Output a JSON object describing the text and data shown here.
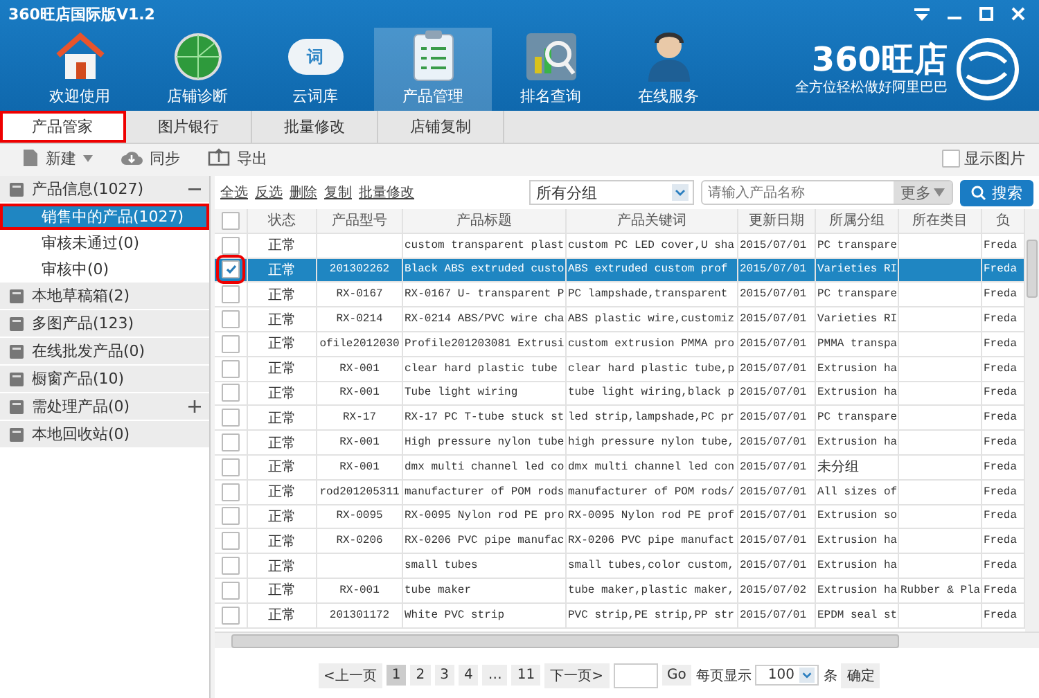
{
  "window": {
    "title": "360旺店国际版V1.2"
  },
  "nav": [
    {
      "label": "欢迎使用",
      "kind": "house",
      "selected": false
    },
    {
      "label": "店铺诊断",
      "kind": "globe",
      "selected": false
    },
    {
      "label": "云词库",
      "kind": "cloud",
      "icon_text": "词",
      "selected": false
    },
    {
      "label": "产品管理",
      "kind": "clipboard",
      "selected": true
    },
    {
      "label": "排名查询",
      "kind": "chart",
      "selected": false
    },
    {
      "label": "在线服务",
      "kind": "person",
      "selected": false
    }
  ],
  "brand": {
    "name": "360旺店",
    "slogan": "全方位轻松做好阿里巴巴"
  },
  "subtabs": [
    {
      "label": "产品管家",
      "selected": true
    },
    {
      "label": "图片银行",
      "selected": false
    },
    {
      "label": "批量修改",
      "selected": false
    },
    {
      "label": "店铺复制",
      "selected": false
    }
  ],
  "toolbar": {
    "buttons": [
      {
        "label": "新建",
        "kind": "doc",
        "dropdown": true
      },
      {
        "label": "同步",
        "kind": "cloud",
        "dropdown": false
      },
      {
        "label": "导出",
        "kind": "export",
        "dropdown": false
      }
    ],
    "show_images": {
      "label": "显示图片",
      "checked": false
    }
  },
  "sidebar": [
    {
      "label": "产品信息(1027)",
      "expanded": true,
      "children": [
        {
          "label": "销售中的产品(1027)",
          "selected": true
        },
        {
          "label": "审核未通过(0)",
          "selected": false
        },
        {
          "label": "审核中(0)",
          "selected": false
        }
      ]
    },
    {
      "label": "本地草稿箱(2)"
    },
    {
      "label": "多图产品(123)"
    },
    {
      "label": "在线批发产品(0)"
    },
    {
      "label": "橱窗产品(10)"
    },
    {
      "label": "需处理产品(0)",
      "expanded": false
    },
    {
      "label": "本地回收站(0)"
    }
  ],
  "actions": [
    "全选",
    "反选",
    "删除",
    "复制",
    "批量修改"
  ],
  "group_filter": {
    "value": "所有分组"
  },
  "search": {
    "placeholder": "请输入产品名称",
    "more": "更多",
    "button": "搜索"
  },
  "table": {
    "all_checked": false,
    "columns": [
      "状态",
      "产品型号",
      "产品标题",
      "产品关键词",
      "更新日期",
      "所属分组",
      "所在类目",
      "负"
    ],
    "rows": [
      {
        "checked": false,
        "selected": false,
        "cells": [
          "正常",
          "",
          "custom transparent plast",
          "custom PC LED cover,U sha",
          "2015/07/01",
          "PC transpare",
          "",
          "Freda"
        ]
      },
      {
        "checked": true,
        "selected": true,
        "cells": [
          "正常",
          "201302262",
          "Black ABS extruded custo",
          "ABS extruded  custom prof",
          "2015/07/01",
          "Varieties RI",
          "",
          "Freda"
        ]
      },
      {
        "checked": false,
        "selected": false,
        "cells": [
          "正常",
          "RX-0167",
          "RX-0167 U- transparent P",
          "PC lampshade,transparent",
          "2015/07/01",
          "PC transpare",
          "",
          "Freda"
        ]
      },
      {
        "checked": false,
        "selected": false,
        "cells": [
          "正常",
          "RX-0214",
          "RX-0214 ABS/PVC wire cha",
          "ABS plastic wire,customiz",
          "2015/07/01",
          "Varieties RI",
          "",
          "Freda"
        ]
      },
      {
        "checked": false,
        "selected": false,
        "cells": [
          "正常",
          "ofile2012030",
          "Profile201203081 Extrusi",
          "custom extrusion PMMA pro",
          "2015/07/01",
          "PMMA transpa",
          "",
          "Freda"
        ]
      },
      {
        "checked": false,
        "selected": false,
        "cells": [
          "正常",
          "RX-001",
          "clear hard plastic tube",
          "clear hard plastic tube,p",
          "2015/07/01",
          "Extrusion ha",
          "",
          "Freda"
        ]
      },
      {
        "checked": false,
        "selected": false,
        "cells": [
          "正常",
          "RX-001",
          "Tube light wiring",
          "tube light wiring,black p",
          "2015/07/01",
          "Extrusion ha",
          "",
          "Freda"
        ]
      },
      {
        "checked": false,
        "selected": false,
        "cells": [
          "正常",
          "RX-17",
          "RX-17 PC T-tube stuck st",
          "led strip,lampshade,PC pr",
          "2015/07/01",
          "PC transpare",
          "",
          "Freda"
        ]
      },
      {
        "checked": false,
        "selected": false,
        "cells": [
          "正常",
          "RX-001",
          "High pressure nylon tube",
          "high pressure nylon tube,",
          "2015/07/01",
          "Extrusion ha",
          "",
          "Freda"
        ]
      },
      {
        "checked": false,
        "selected": false,
        "cells": [
          "正常",
          "RX-001",
          "dmx multi channel led co",
          "dmx multi channel led con",
          "2015/07/01",
          "未分组",
          "",
          "Freda"
        ]
      },
      {
        "checked": false,
        "selected": false,
        "cells": [
          "正常",
          "rod201205311",
          "manufacturer of POM rods",
          "manufacturer of POM rods/",
          "2015/07/01",
          "All sizes of",
          "",
          "Freda"
        ]
      },
      {
        "checked": false,
        "selected": false,
        "cells": [
          "正常",
          "RX-0095",
          "RX-0095 Nylon rod PE pro",
          "RX-0095 Nylon rod PE prof",
          "2015/07/01",
          "Extrusion so",
          "",
          "Freda"
        ]
      },
      {
        "checked": false,
        "selected": false,
        "cells": [
          "正常",
          "RX-0206",
          "RX-0206 PVC pipe manufac",
          "RX-0206 PVC pipe manufact",
          "2015/07/01",
          "Extrusion ha",
          "",
          "Freda"
        ]
      },
      {
        "checked": false,
        "selected": false,
        "cells": [
          "正常",
          "",
          "small tubes",
          "small tubes,color custom,",
          "2015/07/01",
          "Extrusion ha",
          "",
          "Freda"
        ]
      },
      {
        "checked": false,
        "selected": false,
        "cells": [
          "正常",
          "RX-001",
          "tube maker",
          "tube maker,plastic maker,",
          "2015/07/02",
          "Extrusion ha",
          "Rubber & Pla",
          "Freda"
        ]
      },
      {
        "checked": false,
        "selected": false,
        "cells": [
          "正常",
          "201301172",
          "White PVC strip",
          "PVC strip,PE strip,PP str",
          "2015/07/01",
          "EPDM seal st",
          "",
          "Freda"
        ]
      }
    ]
  },
  "pagination": {
    "prev": "<上一页",
    "pages": [
      {
        "label": "1",
        "selected": true
      },
      {
        "label": "2",
        "selected": false
      },
      {
        "label": "3",
        "selected": false
      },
      {
        "label": "4",
        "selected": false
      },
      {
        "label": "…",
        "selected": false
      },
      {
        "label": "11",
        "selected": false
      }
    ],
    "next": "下一页>",
    "go": "Go",
    "per_page_label": "每页显示",
    "per_page": "100",
    "unit": "条",
    "confirm": "确定"
  }
}
